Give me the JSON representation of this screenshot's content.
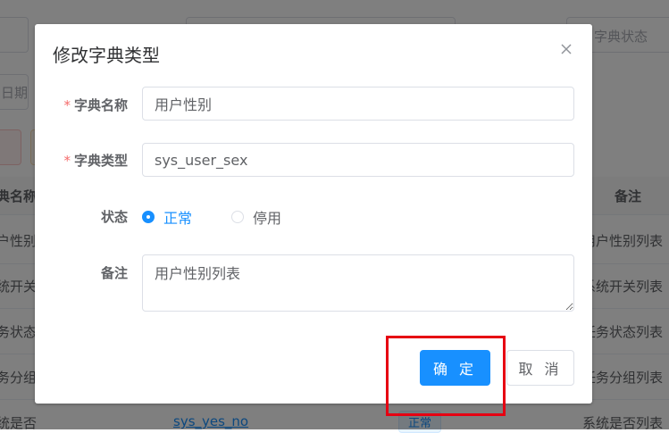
{
  "background": {
    "top_right_placeholder": "字典状态",
    "date_placeholder": "日期",
    "column_dict_name": "典名称",
    "column_remark": "备注",
    "rows_left": [
      "户性别",
      "统开关",
      "务状态",
      "务分组",
      "统是否"
    ],
    "rows_right": [
      "用户性别列表",
      "系统开关列表",
      "任务状态列表",
      "任务分组列表",
      "系统是否列表"
    ],
    "last_row_type": "sys_yes_no",
    "last_row_status": "正常"
  },
  "dialog": {
    "title": "修改字典类型",
    "fields": {
      "dict_name": {
        "label": "字典名称",
        "value": "用户性别"
      },
      "dict_type": {
        "label": "字典类型",
        "value": "sys_user_sex"
      },
      "status": {
        "label": "状态",
        "options": [
          "正常",
          "停用"
        ],
        "selected": "正常"
      },
      "remark": {
        "label": "备注",
        "value": "用户性别列表"
      }
    },
    "required_mark": "*",
    "confirm_label": "确 定",
    "cancel_label": "取 消"
  },
  "colors": {
    "primary": "#1890ff",
    "required": "#f56c6c",
    "highlight": "#e60012"
  }
}
